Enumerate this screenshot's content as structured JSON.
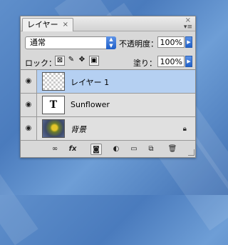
{
  "panel": {
    "tab_label": "レイヤー",
    "tab_close": "×",
    "panel_close": "×",
    "menu_icon": "≡"
  },
  "blend": {
    "mode": "通常",
    "opacity_label": "不透明度：",
    "opacity_value": "100%"
  },
  "lock": {
    "label": "ロック：",
    "fill_label": "塗り：",
    "fill_value": "100%",
    "icons": [
      "lock-transparent-pixels-icon",
      "lock-image-pixels-icon",
      "lock-position-icon",
      "lock-all-icon"
    ]
  },
  "layers": [
    {
      "name": "レイヤー 1",
      "thumb": "transparent",
      "selected": true,
      "visible": true,
      "locked": false
    },
    {
      "name": "Sunflower",
      "thumb": "text",
      "thumb_glyph": "T",
      "selected": false,
      "visible": true,
      "locked": false
    },
    {
      "name": "背景",
      "thumb": "image",
      "selected": false,
      "visible": true,
      "locked": true
    }
  ],
  "colors": {
    "selected_row": "#b5d0f2",
    "accent_arrow": "#2f6fd6"
  },
  "bottom_icons": [
    "link-layers-icon",
    "fx-icon",
    "add-mask-icon",
    "adjustment-layer-icon",
    "new-group-icon",
    "new-layer-icon",
    "delete-layer-icon"
  ],
  "bottom_fx": "fx"
}
